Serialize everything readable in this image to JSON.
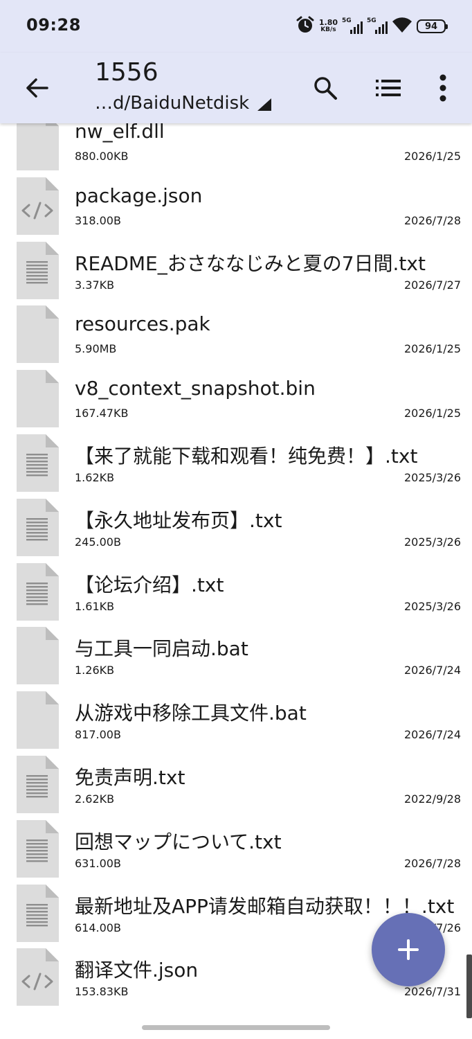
{
  "status": {
    "time": "09:28",
    "speed_value": "1.80",
    "speed_unit": "KB/s",
    "signal1": "5G",
    "signal2": "5G",
    "battery": "94"
  },
  "toolbar": {
    "title": "1556",
    "path": "…d/BaiduNetdisk",
    "icons": [
      "back-arrow-icon",
      "search-icon",
      "list-view-icon",
      "more-vert-icon"
    ]
  },
  "files": [
    {
      "name": "nw_elf.dll",
      "size": "880.00KB",
      "date": "2026/1/25",
      "icon": "file-generic-icon"
    },
    {
      "name": "package.json",
      "size": "318.00B",
      "date": "2026/7/28",
      "icon": "file-code-icon"
    },
    {
      "name": "README_おさななじみと夏の7日間.txt",
      "size": "3.37KB",
      "date": "2026/7/27",
      "icon": "file-text-icon"
    },
    {
      "name": "resources.pak",
      "size": "5.90MB",
      "date": "2026/1/25",
      "icon": "file-generic-icon"
    },
    {
      "name": "v8_context_snapshot.bin",
      "size": "167.47KB",
      "date": "2026/1/25",
      "icon": "file-generic-icon"
    },
    {
      "name": "【来了就能下载和观看！纯免费！】.txt",
      "size": "1.62KB",
      "date": "2025/3/26",
      "icon": "file-text-icon"
    },
    {
      "name": "【永久地址发布页】.txt",
      "size": "245.00B",
      "date": "2025/3/26",
      "icon": "file-text-icon"
    },
    {
      "name": "【论坛介绍】.txt",
      "size": "1.61KB",
      "date": "2025/3/26",
      "icon": "file-text-icon"
    },
    {
      "name": "与工具一同启动.bat",
      "size": "1.26KB",
      "date": "2026/7/24",
      "icon": "file-generic-icon"
    },
    {
      "name": "从游戏中移除工具文件.bat",
      "size": "817.00B",
      "date": "2026/7/24",
      "icon": "file-generic-icon"
    },
    {
      "name": "免责声明.txt",
      "size": "2.62KB",
      "date": "2022/9/28",
      "icon": "file-text-icon"
    },
    {
      "name": "回想マップについて.txt",
      "size": "631.00B",
      "date": "2026/7/28",
      "icon": "file-text-icon"
    },
    {
      "name": "最新地址及APP请发邮箱自动获取！！！.txt",
      "size": "614.00B",
      "date": "2026/7/26",
      "icon": "file-text-icon"
    },
    {
      "name": "翻译文件.json",
      "size": "153.83KB",
      "date": "2026/7/31",
      "icon": "file-code-icon"
    }
  ],
  "fab": {
    "icon": "add-icon"
  },
  "colors": {
    "bar_bg": "#e3e6f7",
    "fab": "#6670b6",
    "file_icon": "#dcdcdc"
  }
}
